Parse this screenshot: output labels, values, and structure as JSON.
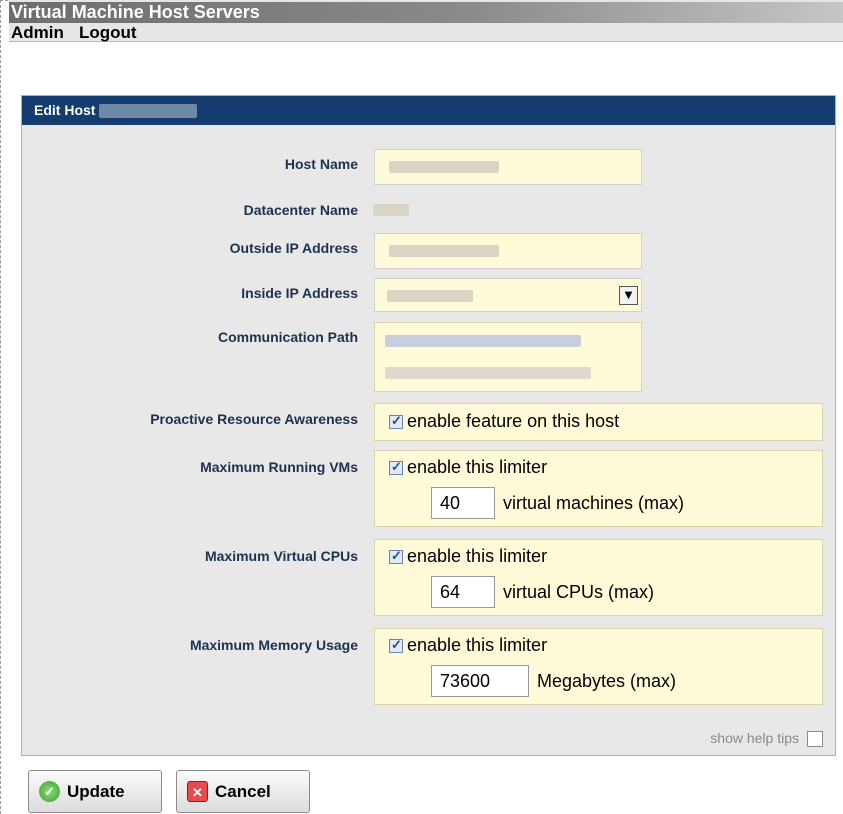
{
  "app": {
    "title": "Virtual Machine Host Servers",
    "menu": [
      "Admin",
      "Logout"
    ]
  },
  "panel": {
    "header_title": "Edit Host",
    "fields": {
      "host_name_label": "Host Name",
      "datacenter_name_label": "Datacenter Name",
      "outside_ip_label": "Outside IP Address",
      "inside_ip_label": "Inside IP Address",
      "communication_path_label": "Communication Path",
      "proactive_label": "Proactive Resource Awareness",
      "max_vms_label": "Maximum Running VMs",
      "max_cpus_label": "Maximum Virtual CPUs",
      "max_memory_label": "Maximum Memory Usage"
    },
    "proactive": {
      "checkbox_text": "enable feature on this host",
      "checked": true
    },
    "max_vms": {
      "checkbox_text": "enable this limiter",
      "checked": true,
      "value": "40",
      "unit": "virtual machines (max)"
    },
    "max_cpus": {
      "checkbox_text": "enable this limiter",
      "checked": true,
      "value": "64",
      "unit": "virtual CPUs (max)"
    },
    "max_memory": {
      "checkbox_text": "enable this limiter",
      "checked": true,
      "value": "73600",
      "unit": "Megabytes (max)"
    },
    "help_tips_label": "show help tips"
  },
  "buttons": {
    "update": "Update",
    "cancel": "Cancel"
  },
  "icons": {
    "update": "check-circle-icon",
    "cancel": "x-square-icon",
    "select": "chevron-down-icon"
  },
  "colors": {
    "header_bg": "#143c6e",
    "field_bg": "#fffbd9",
    "label_color": "#1d3150"
  }
}
